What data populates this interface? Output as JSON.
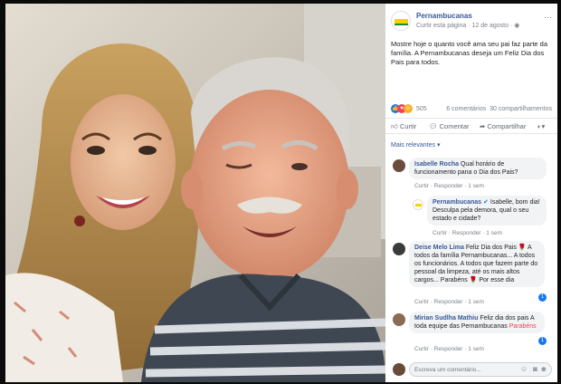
{
  "photo": {
    "alt_subjects": [
      "woman-smiling",
      "older-man-winking"
    ]
  },
  "post": {
    "page_name": "Pernambucanas",
    "follow_label": "Curtir esta página",
    "date": "12 de agosto",
    "privacy_icon": "globe-icon",
    "text": "Mostre hoje o quanto você ama seu pai faz parte da família. A Pernambucanas deseja um Feliz Dia dos Pais para todos.",
    "reactions_count": "505",
    "comments_count": "6 comentários",
    "shares_count": "30 compartilhamentos"
  },
  "actions": {
    "like": "Curtir",
    "comment": "Comentar",
    "share": "Compartilhar"
  },
  "sort_label": "Mais relevantes",
  "comment_actions": {
    "like": "Curtir",
    "reply": "Responder"
  },
  "comments": [
    {
      "author": "Isabelle Rocha",
      "text": "Qual horário de funcionamento pana o Dia dos Pais?",
      "time": "1 sem"
    },
    {
      "author": "Pernambucanas",
      "text": "Isabelle, bom dia! Desculpa pela demora, qual o seu estado e cidade?",
      "time": "1 sem",
      "reply": true
    },
    {
      "author": "Deise Melo Lima",
      "text": "Feliz Dia dos Pais 🌹 A todos da família Pernambucanas... A todos os funcionários. A todos que fazem parte do pessoal da limpeza, até os mais altos cargos... Parabéns 🌹 Por esse dia",
      "time": "1 sem",
      "badge": "1"
    },
    {
      "author": "Mirian Sudlha Mathiu",
      "text": "Feliz dia dos pais A toda equipe das Pernambucanas",
      "highlight": "Parabéns",
      "time": "1 sem",
      "badge": "1"
    }
  ],
  "composer": {
    "placeholder": "Escreva um comentário..."
  },
  "colors": {
    "fb_blue": "#385898",
    "like_blue": "#1877f2",
    "love_red": "#f33e58",
    "haha_yellow": "#f7b125",
    "brand_yellow": "#f5d200",
    "brand_green": "#1c8a3a"
  }
}
